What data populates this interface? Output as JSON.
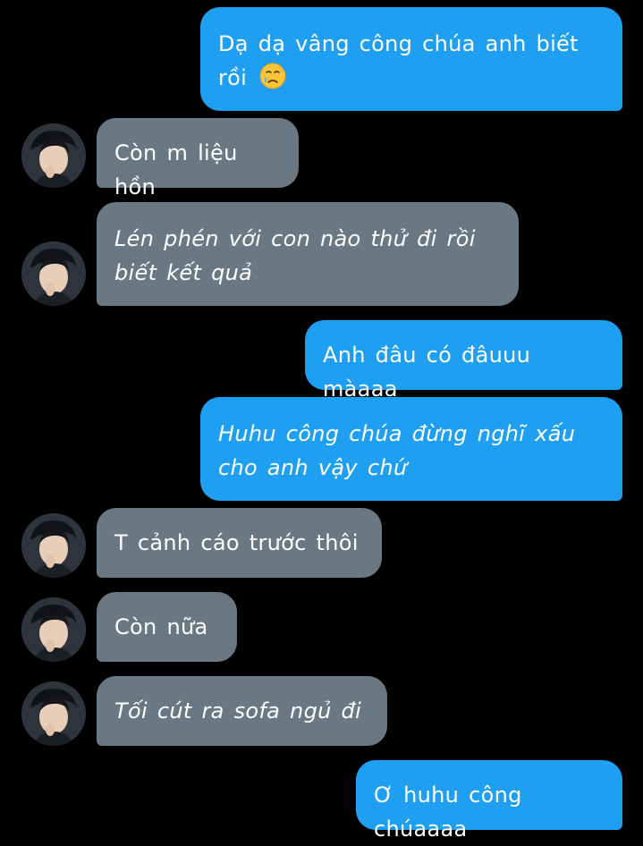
{
  "conversation": {
    "messages": [
      {
        "sender": "me",
        "text": "Dạ dạ vâng công chúa anh biết rồi",
        "emoji": "face-holding-back-tears-icon"
      },
      {
        "sender": "other",
        "text": "Còn m liệu hồn"
      },
      {
        "sender": "other",
        "text": "Lén phén với con nào thử đi rồi biết kết quả"
      },
      {
        "sender": "me",
        "text": "Anh đâu có đâuuu màaaa"
      },
      {
        "sender": "me",
        "text": "Huhu công chúa đừng nghĩ xấu cho anh vậy chứ"
      },
      {
        "sender": "other",
        "text": "T cảnh cáo trước thôi"
      },
      {
        "sender": "other",
        "text": "Còn nữa"
      },
      {
        "sender": "other",
        "text": "Tối cút ra sofa ngủ đi"
      },
      {
        "sender": "me",
        "text": "Ơ huhu công chúaaaa"
      }
    ]
  },
  "colors": {
    "background": "#000000",
    "sent_bubble": "#1e9ff2",
    "received_bubble": "#6a7884",
    "text": "#ffffff"
  }
}
